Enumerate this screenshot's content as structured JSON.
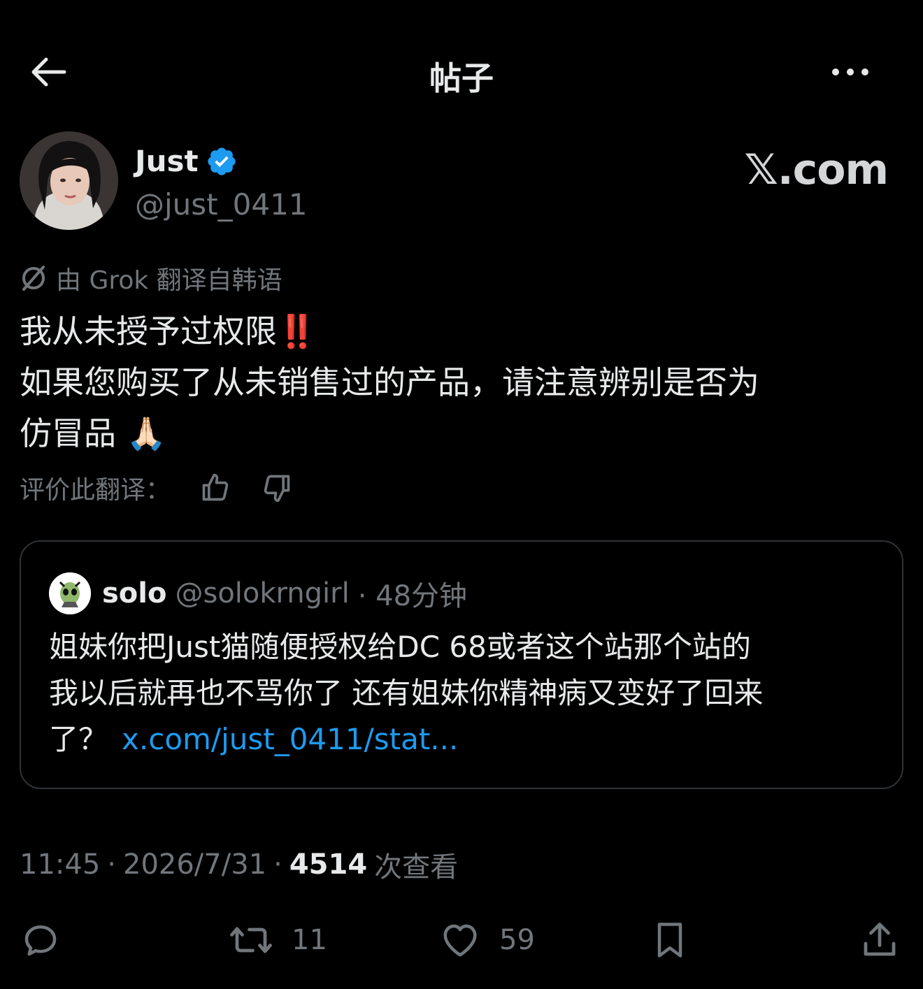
{
  "header": {
    "title": "帖子"
  },
  "author": {
    "name": "Just",
    "handle": "@just_0411"
  },
  "watermark": "𝕏.com",
  "translation": {
    "note": "由 Grok 翻译自韩语",
    "rate_label": "评价此翻译："
  },
  "tweet": {
    "lines": [
      "我从未授予过权限‼️",
      "如果您购买了从未销售过的产品，请注意辨别是否为",
      "仿冒品 🙏🏻"
    ]
  },
  "quote": {
    "name": "solo",
    "handle": "@solokrngirl",
    "time": "· 48分钟",
    "lines": [
      "姐妹你把Just猫随便授权给DC 68或者这个站那个站的",
      "我以后就再也不骂你了 还有姐妹你精神病又变好了回来",
      "了？"
    ],
    "link": "x.com/just_0411/stat..."
  },
  "meta": {
    "time": "11:45",
    "date": "2026/7/31",
    "views_count": "4514",
    "views_label": "次查看",
    "sep": "·"
  },
  "actions": {
    "reposts": "11",
    "likes": "59"
  },
  "colors": {
    "accent": "#1d9bf0",
    "verified": "#1d9bf0",
    "muted": "#71767b",
    "text": "#e7e9ea",
    "background": "#000000",
    "border": "#2f3336"
  }
}
